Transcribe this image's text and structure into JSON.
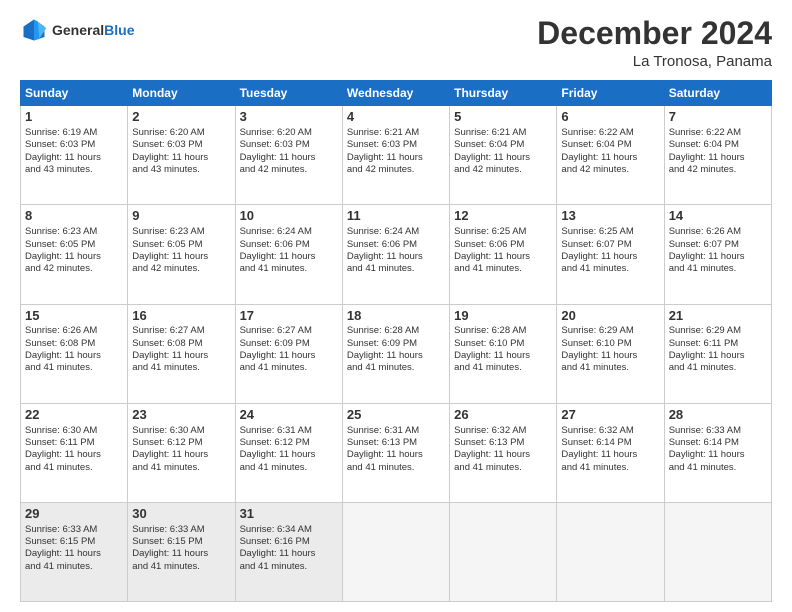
{
  "header": {
    "logo_general": "General",
    "logo_blue": "Blue",
    "month_year": "December 2024",
    "location": "La Tronosa, Panama"
  },
  "weekdays": [
    "Sunday",
    "Monday",
    "Tuesday",
    "Wednesday",
    "Thursday",
    "Friday",
    "Saturday"
  ],
  "weeks": [
    [
      {
        "day": 1,
        "lines": [
          "Sunrise: 6:19 AM",
          "Sunset: 6:03 PM",
          "Daylight: 11 hours",
          "and 43 minutes."
        ]
      },
      {
        "day": 2,
        "lines": [
          "Sunrise: 6:20 AM",
          "Sunset: 6:03 PM",
          "Daylight: 11 hours",
          "and 43 minutes."
        ]
      },
      {
        "day": 3,
        "lines": [
          "Sunrise: 6:20 AM",
          "Sunset: 6:03 PM",
          "Daylight: 11 hours",
          "and 42 minutes."
        ]
      },
      {
        "day": 4,
        "lines": [
          "Sunrise: 6:21 AM",
          "Sunset: 6:03 PM",
          "Daylight: 11 hours",
          "and 42 minutes."
        ]
      },
      {
        "day": 5,
        "lines": [
          "Sunrise: 6:21 AM",
          "Sunset: 6:04 PM",
          "Daylight: 11 hours",
          "and 42 minutes."
        ]
      },
      {
        "day": 6,
        "lines": [
          "Sunrise: 6:22 AM",
          "Sunset: 6:04 PM",
          "Daylight: 11 hours",
          "and 42 minutes."
        ]
      },
      {
        "day": 7,
        "lines": [
          "Sunrise: 6:22 AM",
          "Sunset: 6:04 PM",
          "Daylight: 11 hours",
          "and 42 minutes."
        ]
      }
    ],
    [
      {
        "day": 8,
        "lines": [
          "Sunrise: 6:23 AM",
          "Sunset: 6:05 PM",
          "Daylight: 11 hours",
          "and 42 minutes."
        ]
      },
      {
        "day": 9,
        "lines": [
          "Sunrise: 6:23 AM",
          "Sunset: 6:05 PM",
          "Daylight: 11 hours",
          "and 42 minutes."
        ]
      },
      {
        "day": 10,
        "lines": [
          "Sunrise: 6:24 AM",
          "Sunset: 6:06 PM",
          "Daylight: 11 hours",
          "and 41 minutes."
        ]
      },
      {
        "day": 11,
        "lines": [
          "Sunrise: 6:24 AM",
          "Sunset: 6:06 PM",
          "Daylight: 11 hours",
          "and 41 minutes."
        ]
      },
      {
        "day": 12,
        "lines": [
          "Sunrise: 6:25 AM",
          "Sunset: 6:06 PM",
          "Daylight: 11 hours",
          "and 41 minutes."
        ]
      },
      {
        "day": 13,
        "lines": [
          "Sunrise: 6:25 AM",
          "Sunset: 6:07 PM",
          "Daylight: 11 hours",
          "and 41 minutes."
        ]
      },
      {
        "day": 14,
        "lines": [
          "Sunrise: 6:26 AM",
          "Sunset: 6:07 PM",
          "Daylight: 11 hours",
          "and 41 minutes."
        ]
      }
    ],
    [
      {
        "day": 15,
        "lines": [
          "Sunrise: 6:26 AM",
          "Sunset: 6:08 PM",
          "Daylight: 11 hours",
          "and 41 minutes."
        ]
      },
      {
        "day": 16,
        "lines": [
          "Sunrise: 6:27 AM",
          "Sunset: 6:08 PM",
          "Daylight: 11 hours",
          "and 41 minutes."
        ]
      },
      {
        "day": 17,
        "lines": [
          "Sunrise: 6:27 AM",
          "Sunset: 6:09 PM",
          "Daylight: 11 hours",
          "and 41 minutes."
        ]
      },
      {
        "day": 18,
        "lines": [
          "Sunrise: 6:28 AM",
          "Sunset: 6:09 PM",
          "Daylight: 11 hours",
          "and 41 minutes."
        ]
      },
      {
        "day": 19,
        "lines": [
          "Sunrise: 6:28 AM",
          "Sunset: 6:10 PM",
          "Daylight: 11 hours",
          "and 41 minutes."
        ]
      },
      {
        "day": 20,
        "lines": [
          "Sunrise: 6:29 AM",
          "Sunset: 6:10 PM",
          "Daylight: 11 hours",
          "and 41 minutes."
        ]
      },
      {
        "day": 21,
        "lines": [
          "Sunrise: 6:29 AM",
          "Sunset: 6:11 PM",
          "Daylight: 11 hours",
          "and 41 minutes."
        ]
      }
    ],
    [
      {
        "day": 22,
        "lines": [
          "Sunrise: 6:30 AM",
          "Sunset: 6:11 PM",
          "Daylight: 11 hours",
          "and 41 minutes."
        ]
      },
      {
        "day": 23,
        "lines": [
          "Sunrise: 6:30 AM",
          "Sunset: 6:12 PM",
          "Daylight: 11 hours",
          "and 41 minutes."
        ]
      },
      {
        "day": 24,
        "lines": [
          "Sunrise: 6:31 AM",
          "Sunset: 6:12 PM",
          "Daylight: 11 hours",
          "and 41 minutes."
        ]
      },
      {
        "day": 25,
        "lines": [
          "Sunrise: 6:31 AM",
          "Sunset: 6:13 PM",
          "Daylight: 11 hours",
          "and 41 minutes."
        ]
      },
      {
        "day": 26,
        "lines": [
          "Sunrise: 6:32 AM",
          "Sunset: 6:13 PM",
          "Daylight: 11 hours",
          "and 41 minutes."
        ]
      },
      {
        "day": 27,
        "lines": [
          "Sunrise: 6:32 AM",
          "Sunset: 6:14 PM",
          "Daylight: 11 hours",
          "and 41 minutes."
        ]
      },
      {
        "day": 28,
        "lines": [
          "Sunrise: 6:33 AM",
          "Sunset: 6:14 PM",
          "Daylight: 11 hours",
          "and 41 minutes."
        ]
      }
    ],
    [
      {
        "day": 29,
        "lines": [
          "Sunrise: 6:33 AM",
          "Sunset: 6:15 PM",
          "Daylight: 11 hours",
          "and 41 minutes."
        ]
      },
      {
        "day": 30,
        "lines": [
          "Sunrise: 6:33 AM",
          "Sunset: 6:15 PM",
          "Daylight: 11 hours",
          "and 41 minutes."
        ]
      },
      {
        "day": 31,
        "lines": [
          "Sunrise: 6:34 AM",
          "Sunset: 6:16 PM",
          "Daylight: 11 hours",
          "and 41 minutes."
        ]
      },
      null,
      null,
      null,
      null
    ]
  ]
}
